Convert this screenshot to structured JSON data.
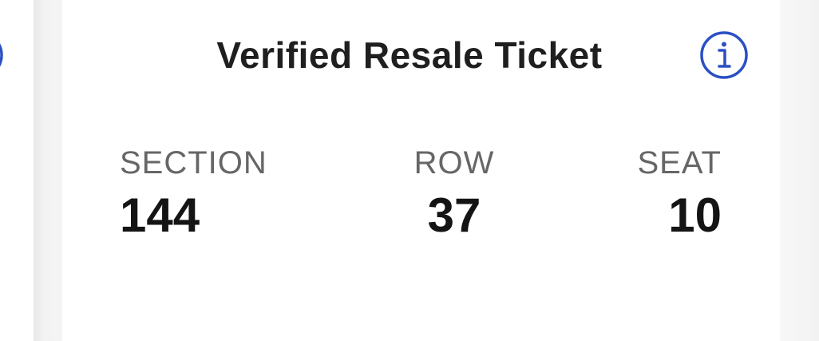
{
  "ticket": {
    "title": "Verified Resale Ticket",
    "info_icon": "info-circle-icon",
    "accent_color": "#2b4fc4"
  },
  "seating": {
    "section": {
      "label": "SECTION",
      "value": "144"
    },
    "row": {
      "label": "ROW",
      "value": "37"
    },
    "seat": {
      "label": "SEAT",
      "value": "10"
    }
  }
}
